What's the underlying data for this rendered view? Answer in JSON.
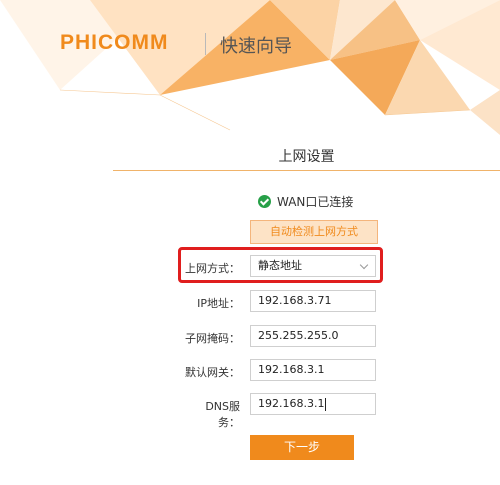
{
  "header": {
    "logo_text": "PHICOMM",
    "wizard_title": "快速向导"
  },
  "section": {
    "title": "上网设置"
  },
  "status": {
    "text": "WAN口已连接",
    "color": "#27a048"
  },
  "detect_button": {
    "label": "自动检测上网方式"
  },
  "form": {
    "connection_type": {
      "label": "上网方式：",
      "value": "静态地址"
    },
    "ip": {
      "label": "IP地址：",
      "value": "192.168.3.71"
    },
    "subnet": {
      "label": "子网掩码：",
      "value": "255.255.255.0"
    },
    "gateway": {
      "label": "默认网关：",
      "value": "192.168.3.1"
    },
    "dns": {
      "label": "DNS服务：",
      "value": "192.168.3.1"
    }
  },
  "next_button": {
    "label": "下一步"
  },
  "colors": {
    "brand": "#f08a1c",
    "highlight": "#e01e1e"
  }
}
